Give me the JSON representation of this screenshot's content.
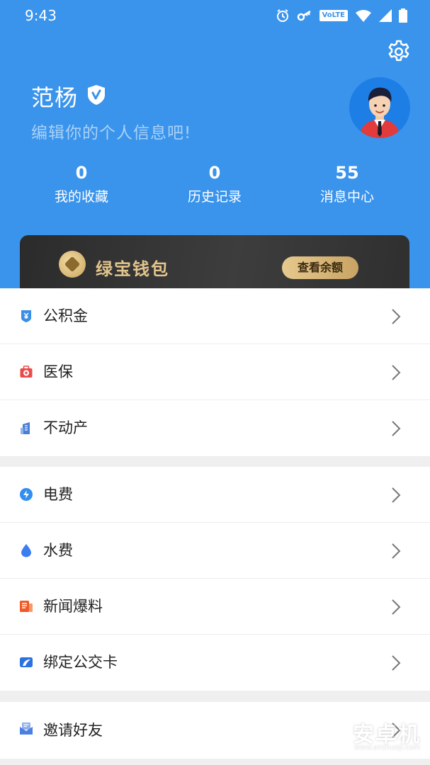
{
  "status_bar": {
    "time": "9:43",
    "volte": "VoLTE"
  },
  "profile": {
    "name": "范杨",
    "hint": "编辑你的个人信息吧!"
  },
  "stats": [
    {
      "value": "0",
      "label": "我的收藏"
    },
    {
      "value": "0",
      "label": "历史记录"
    },
    {
      "value": "55",
      "label": "消息中心"
    }
  ],
  "wallet": {
    "title": "绿宝钱包",
    "button_label": "查看余额"
  },
  "sections": [
    {
      "items": [
        {
          "label": "公积金",
          "icon": "yuan-shield-icon",
          "color": "#3a8ee6"
        },
        {
          "label": "医保",
          "icon": "medical-kit-icon",
          "color": "#e94b4b"
        },
        {
          "label": "不动产",
          "icon": "building-icon",
          "color": "#4a7fd6"
        }
      ]
    },
    {
      "items": [
        {
          "label": "电费",
          "icon": "lightning-icon",
          "color": "#2f8ef0"
        },
        {
          "label": "水费",
          "icon": "water-drop-icon",
          "color": "#3b7ef0"
        },
        {
          "label": "新闻爆料",
          "icon": "news-icon",
          "color": "#f05a2a"
        },
        {
          "label": "绑定公交卡",
          "icon": "bus-card-icon",
          "color": "#2a72e0"
        }
      ]
    },
    {
      "items": [
        {
          "label": "邀请好友",
          "icon": "invite-envelope-icon",
          "color": "#4b7fe0"
        }
      ]
    }
  ],
  "watermark": {
    "text": "安卓机",
    "sub": "www.anzhuoji.com"
  },
  "colors": {
    "header_bg": "#3a94ec",
    "wallet_gold": "#e2c58d"
  }
}
